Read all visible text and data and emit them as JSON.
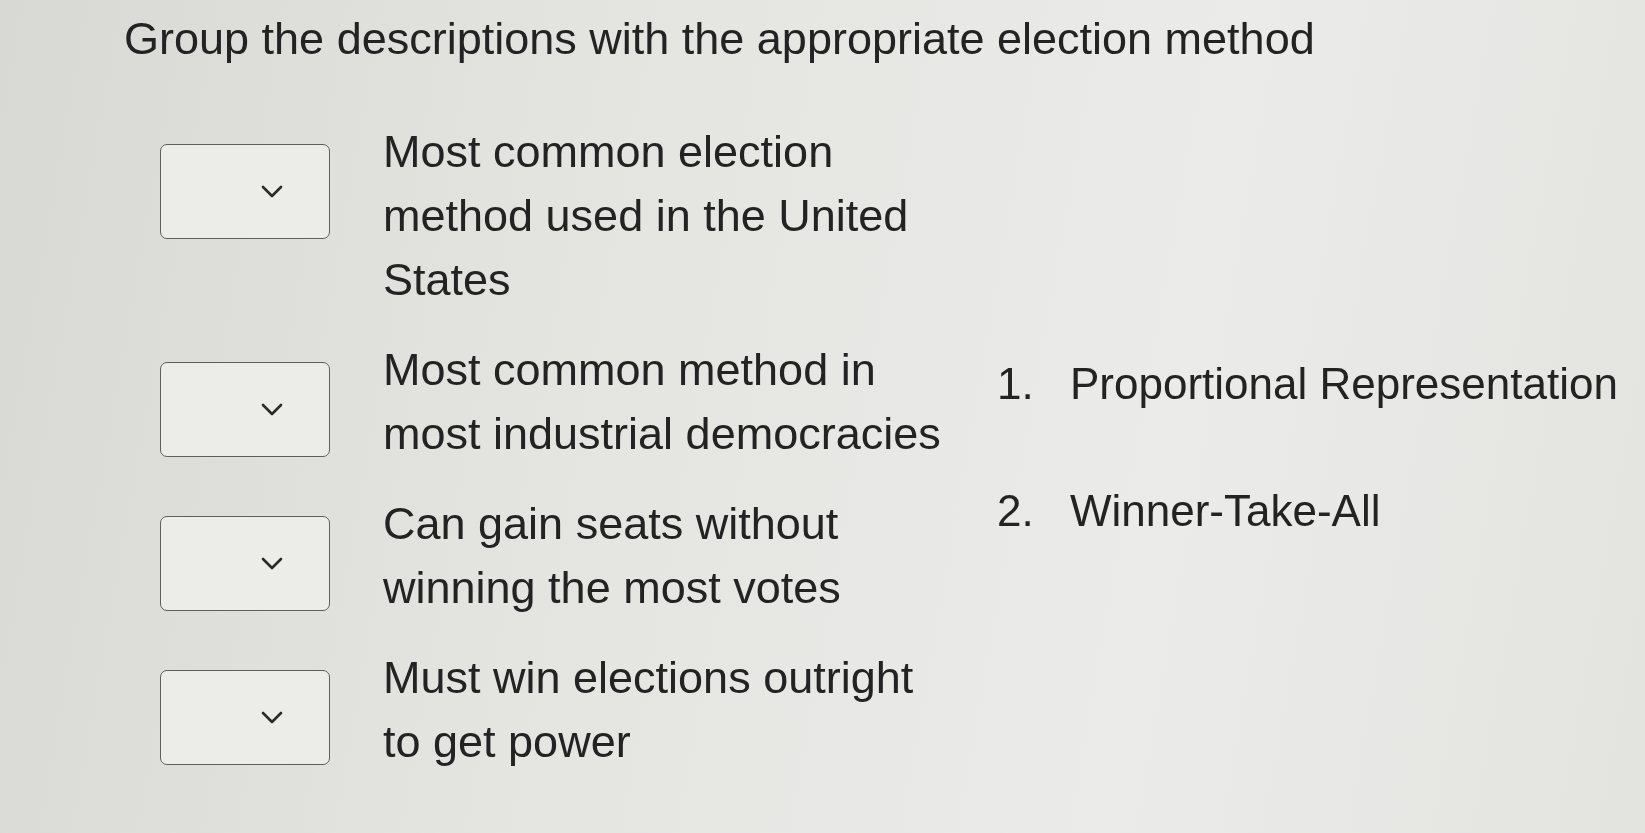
{
  "title": "Group the descriptions with the appropriate election method",
  "items": [
    {
      "description": "Most common election method used in the United States"
    },
    {
      "description": "Most common method in most industrial democracies"
    },
    {
      "description": "Can gain seats without winning the most votes"
    },
    {
      "description": "Must win elections outright to get power"
    }
  ],
  "options": [
    {
      "number": "1.",
      "label": "Proportional Representation"
    },
    {
      "number": "2.",
      "label": "Winner-Take-All"
    }
  ]
}
